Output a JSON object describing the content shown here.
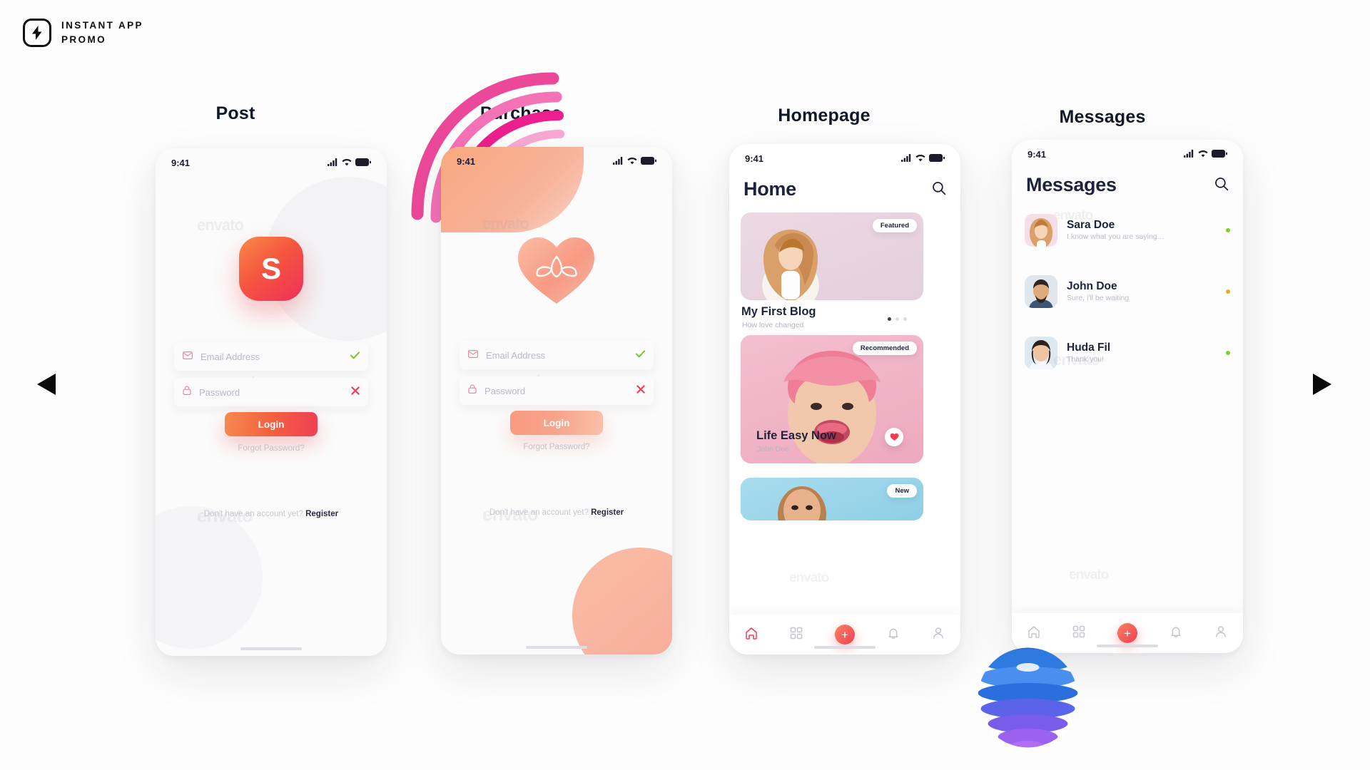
{
  "brand": {
    "line1": "INSTANT APP",
    "line2": "PROMO",
    "icon": "lightning-bolt-icon"
  },
  "nav": {
    "prev": "prev-arrow",
    "next": "next-arrow"
  },
  "watermark": "envato",
  "colors": {
    "accent_orange": "#f4603f",
    "accent_red": "#ef3f55",
    "accent_pink": "#f58ba0",
    "heading": "#1d2338",
    "muted": "#bdbdc8",
    "green": "#8bc34a",
    "badge_white": "#ffffff"
  },
  "panels": [
    {
      "title": "Post"
    },
    {
      "title": "Purchase"
    },
    {
      "title": "Homepage"
    },
    {
      "title": "Messages"
    }
  ],
  "status_bar": {
    "time": "9:41",
    "signal": "signal-icon",
    "wifi": "wifi-icon",
    "battery": "battery-icon"
  },
  "login": {
    "logo_letter": "S",
    "logo_glyph_purchase": "lotus-flower-icon",
    "email": {
      "label": "Email Address",
      "icon": "envelope-icon",
      "status": "valid-check-icon"
    },
    "password": {
      "label": "Password",
      "icon": "lock-icon",
      "status": "invalid-cross-icon"
    },
    "login_button": "Login",
    "forgot": "Forgot Password?",
    "register_prompt": "Don't have an account yet?",
    "register_link": "Register"
  },
  "home": {
    "title": "Home",
    "ghost_title": "Homepage",
    "search_icon": "search-icon",
    "cards": [
      {
        "badge": "Featured",
        "title": "My First Blog",
        "subtitle": "How love changed",
        "tint": "#ecd9e2"
      },
      {
        "badge": "Recommended",
        "title": "Life Easy Now",
        "subtitle": "John Doe",
        "tint": "#f4c2d0"
      },
      {
        "badge": "New",
        "title": "",
        "subtitle": "",
        "tint": "#a9dced"
      }
    ],
    "carousel_dots": {
      "count": 3,
      "active": 0
    },
    "tabbar": [
      {
        "icon": "home-icon",
        "active": true
      },
      {
        "icon": "grid-icon",
        "active": false
      },
      {
        "icon": "plus-fab-icon",
        "active": false
      },
      {
        "icon": "bell-icon",
        "active": false
      },
      {
        "icon": "person-icon",
        "active": false
      }
    ]
  },
  "messages": {
    "title": "Messages",
    "ghost_title": "Messages",
    "search_icon": "search-icon",
    "threads": [
      {
        "name": "Sara Doe",
        "preview": "I know what you are saying...",
        "dot": "#7ed321"
      },
      {
        "name": "John Doe",
        "preview": "Sure, i'll be waiting",
        "dot": "#f5a623"
      },
      {
        "name": "Huda Fil",
        "preview": "Thank you!",
        "dot": "#7ed321"
      }
    ],
    "tabbar": [
      {
        "icon": "home-icon",
        "active": false
      },
      {
        "icon": "grid-icon",
        "active": false
      },
      {
        "icon": "plus-fab-icon",
        "active": false
      },
      {
        "icon": "bell-icon",
        "active": false
      },
      {
        "icon": "person-icon",
        "active": false
      }
    ]
  }
}
